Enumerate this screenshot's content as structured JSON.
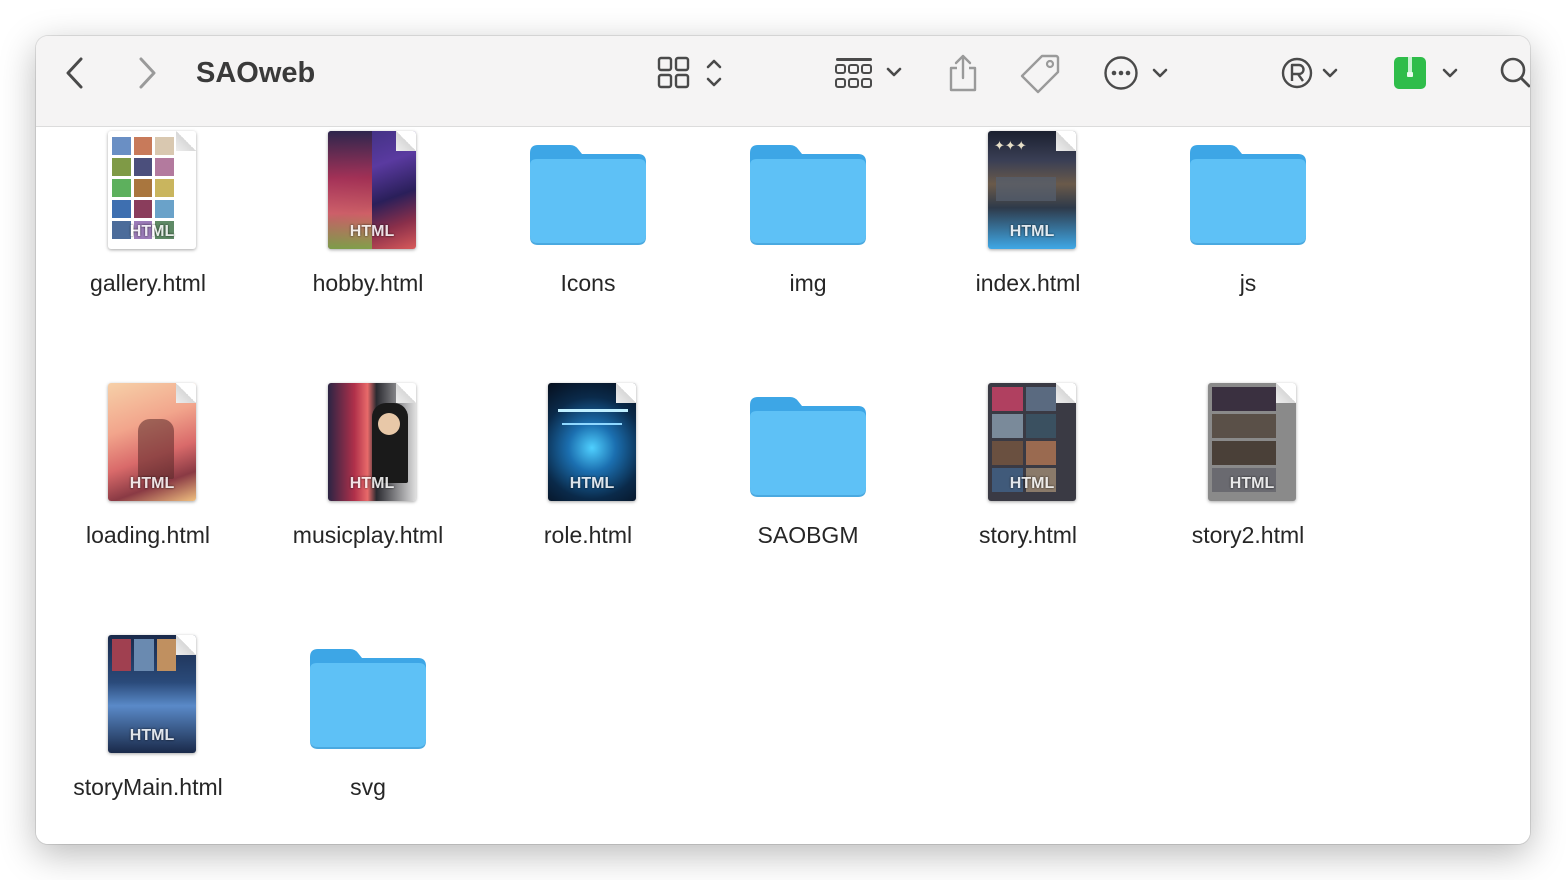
{
  "window": {
    "title": "SAOweb"
  },
  "toolbar": {
    "back_icon": "chevron-left-icon",
    "forward_icon": "chevron-right-icon",
    "view_icon": "icon-grid-view-icon",
    "group_icon": "group-by-icon",
    "share_icon": "share-icon",
    "tag_icon": "tag-icon",
    "more_icon": "ellipsis-circle-icon",
    "registered_icon": "registered-trademark-icon",
    "archive_icon": "green-zip-icon",
    "search_icon": "search-icon"
  },
  "files": [
    {
      "name": "gallery.html",
      "kind": "html",
      "tag": "HTML"
    },
    {
      "name": "hobby.html",
      "kind": "html",
      "tag": "HTML"
    },
    {
      "name": "Icons",
      "kind": "folder"
    },
    {
      "name": "img",
      "kind": "folder"
    },
    {
      "name": "index.html",
      "kind": "html",
      "tag": "HTML"
    },
    {
      "name": "js",
      "kind": "folder"
    },
    {
      "name": "loading.html",
      "kind": "html",
      "tag": "HTML"
    },
    {
      "name": "musicplay.html",
      "kind": "html",
      "tag": "HTML"
    },
    {
      "name": "role.html",
      "kind": "html",
      "tag": "HTML"
    },
    {
      "name": "SAOBGM",
      "kind": "folder"
    },
    {
      "name": "story.html",
      "kind": "html",
      "tag": "HTML"
    },
    {
      "name": "story2.html",
      "kind": "html",
      "tag": "HTML"
    },
    {
      "name": "storyMain.html",
      "kind": "html",
      "tag": "HTML"
    },
    {
      "name": "svg",
      "kind": "folder"
    }
  ],
  "colors": {
    "folder_body": "#5ec1f6",
    "folder_tab": "#3da6e6",
    "accent_green": "#2fbd4a",
    "toolbar_bg": "#f5f4f4"
  }
}
